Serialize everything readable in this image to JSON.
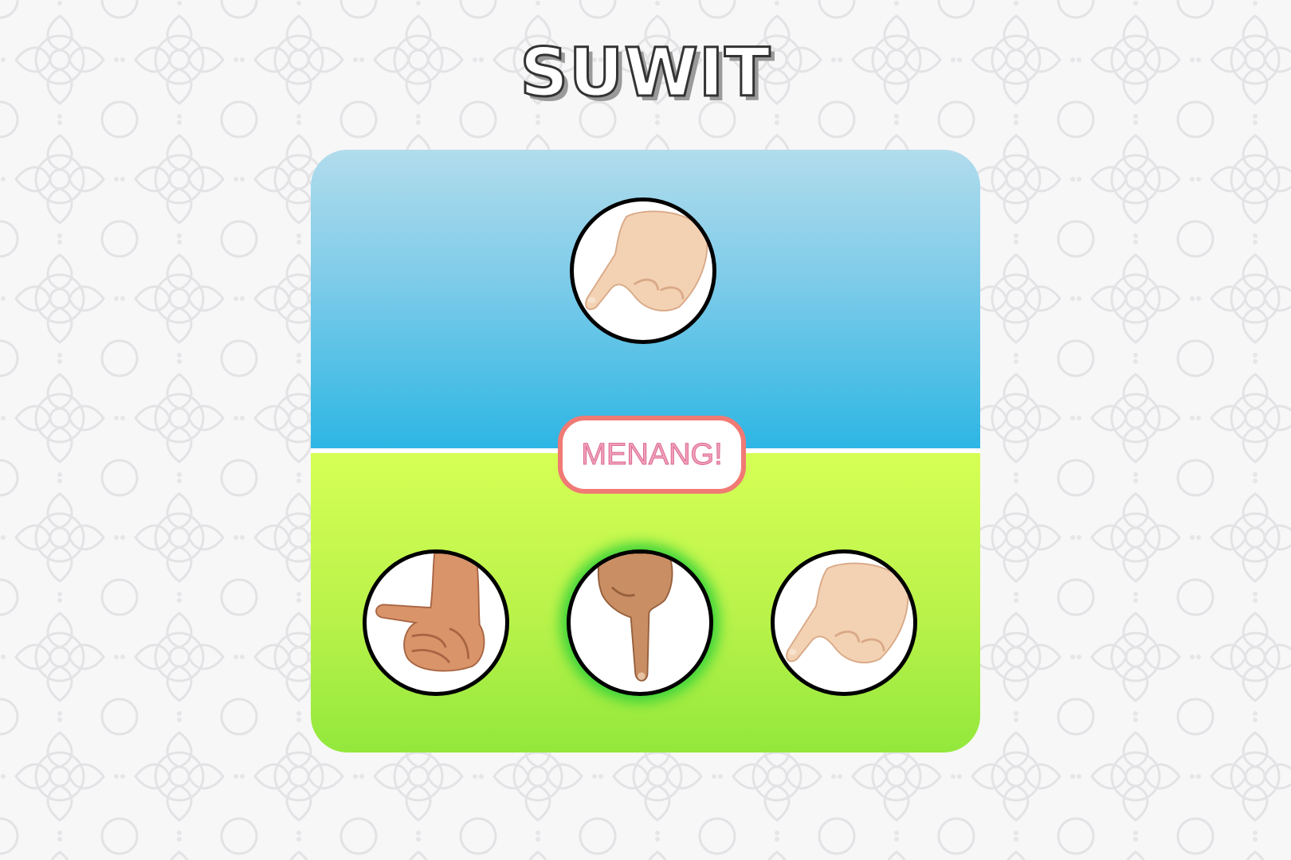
{
  "title": "SUWIT",
  "result_text": "MENANG!",
  "opponent": {
    "hand": "ant-pinky-icon"
  },
  "player_choices": [
    {
      "hand": "elephant-thumb-icon",
      "selected": false
    },
    {
      "hand": "human-index-icon",
      "selected": true
    },
    {
      "hand": "ant-pinky-icon",
      "selected": false
    }
  ],
  "colors": {
    "top_panel": "#2db6e4",
    "bottom_panel": "#b9f24a",
    "selected_glow": "#3cd43a",
    "result_border": "#f07a74",
    "result_text": "#f2a0bb"
  }
}
